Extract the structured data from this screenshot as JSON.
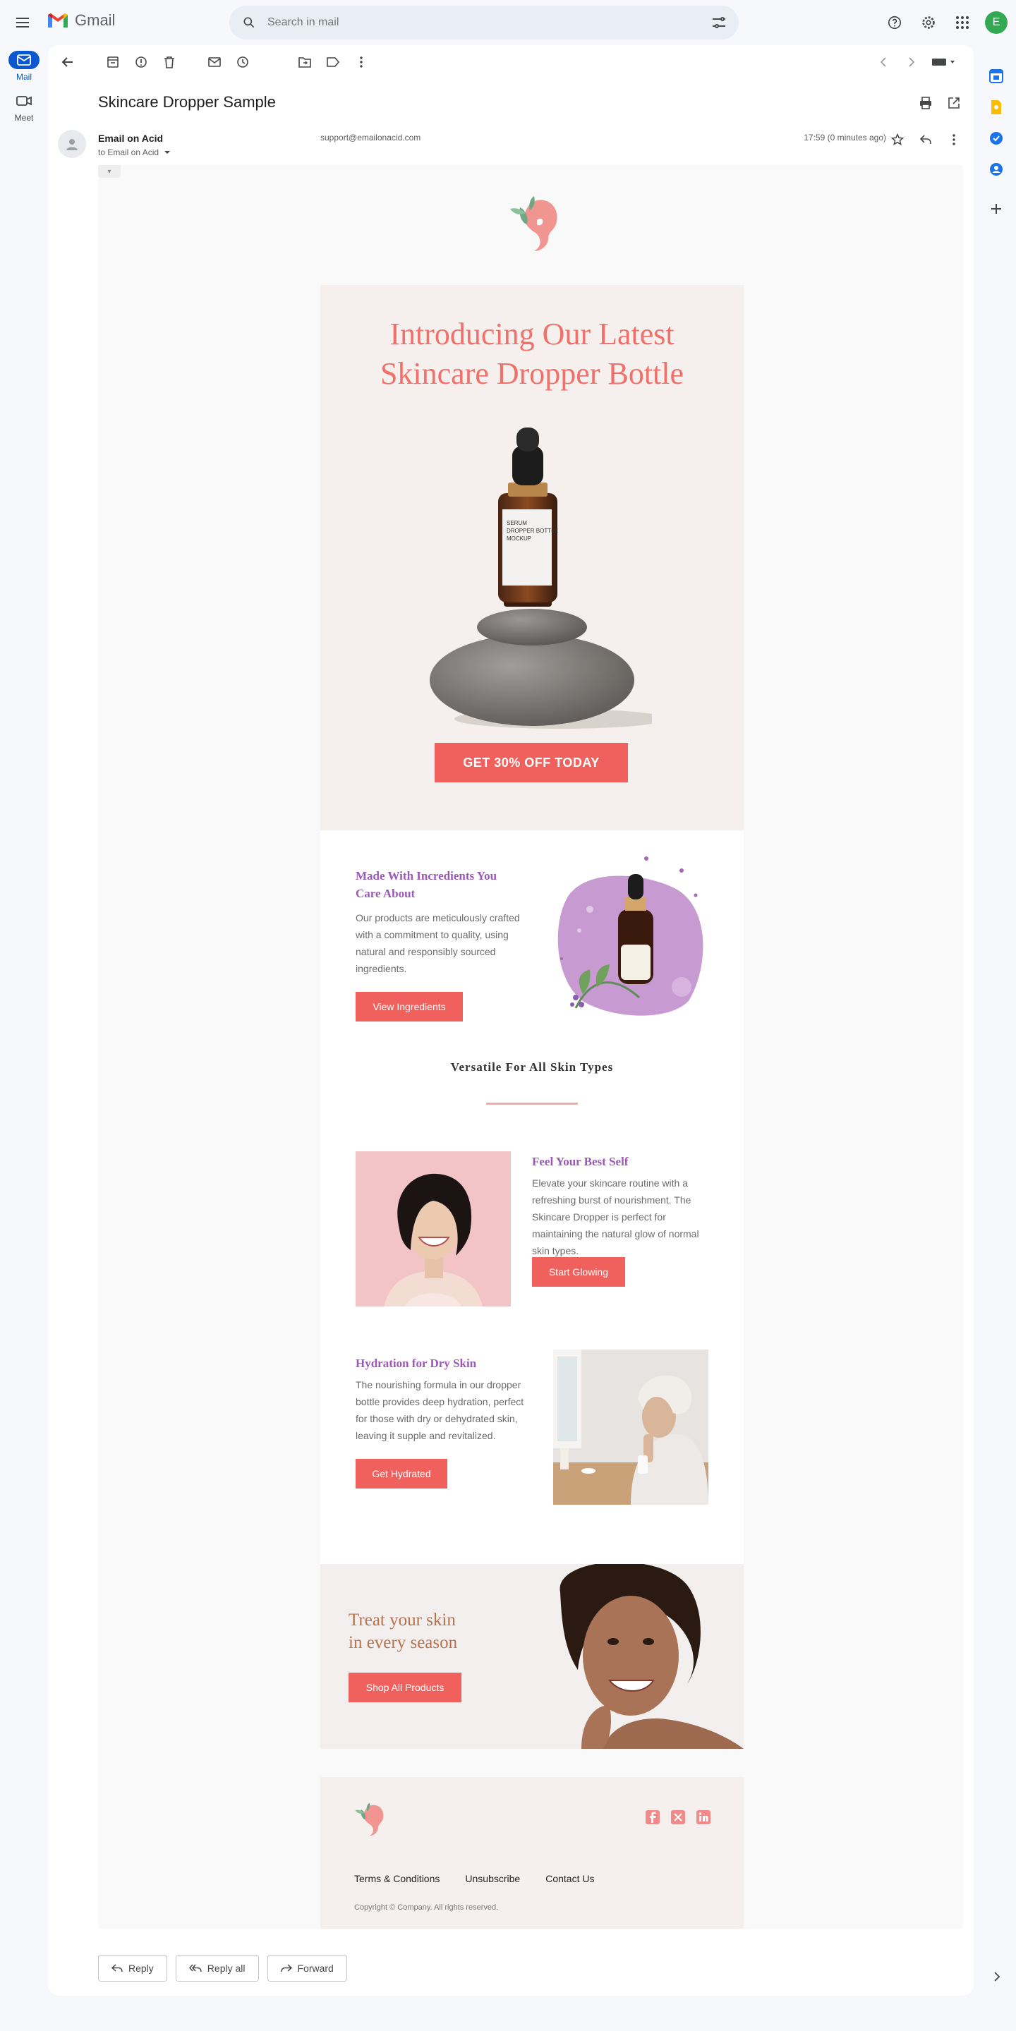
{
  "app": {
    "name": "Gmail",
    "search_placeholder": "Search in mail",
    "avatar_letter": "E",
    "brand_color": "#0b57d0"
  },
  "nav": [
    {
      "label": "Mail",
      "active": true
    },
    {
      "label": "Meet",
      "active": false
    }
  ],
  "message": {
    "subject": "Skincare Dropper Sample",
    "sender_name": "Email on Acid",
    "sender_email": "support@emailonacid.com",
    "to": "to Email on Acid",
    "time": "17:59 (0 minutes ago)"
  },
  "email_body": {
    "hero": {
      "title_line1": "Introducing Our Latest",
      "title_line2": "Skincare Dropper Bottle",
      "bottle_label": "SERUM DROPPER BOTTLE MOCKUP",
      "cta": "GET 30% OFF TODAY"
    },
    "ingredients": {
      "title_line1": "Made With Incredients You",
      "title_line2": "Care About",
      "text": "Our products are meticulously crafted with a commitment to quality, using natural and responsibly sourced ingredients.",
      "cta": "View Ingredients"
    },
    "versatile": {
      "title": "Versatile For All Skin Types"
    },
    "feel": {
      "title": "Feel Your Best Self",
      "text": "Elevate your skincare routine with a refreshing burst of nourishment. The Skincare Dropper is perfect for maintaining the natural glow of normal skin types.",
      "cta": "Start Glowing"
    },
    "hydration": {
      "title": "Hydration for Dry Skin",
      "text": "The nourishing formula in our dropper bottle provides deep hydration, perfect for those with dry or dehydrated skin, leaving it supple and revitalized.",
      "cta": "Get Hydrated"
    },
    "season": {
      "title_line1": "Treat your skin",
      "title_line2": "in every season",
      "cta": "Shop All Products"
    },
    "footer": {
      "links": [
        "Terms & Conditions",
        "Unsubscribe",
        "Contact Us"
      ],
      "copyright": "Copyright © Company. All rights reserved."
    },
    "colors": {
      "accent": "#f0605d",
      "title_coral": "#f0706a",
      "purple": "#9b59b6",
      "season_text": "#b9724a",
      "hero_bg": "#f5f0ed"
    }
  },
  "reply_actions": [
    "Reply",
    "Reply all",
    "Forward"
  ]
}
